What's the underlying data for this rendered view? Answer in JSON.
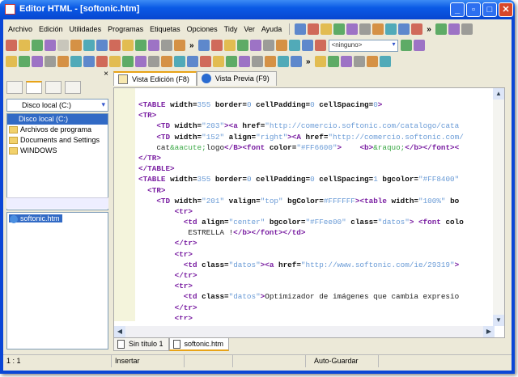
{
  "window": {
    "title": "Editor HTML - [softonic.htm]",
    "controls": [
      "_",
      "▫",
      "□",
      "✕"
    ]
  },
  "menu": [
    "Archivo",
    "Edición",
    "Utilidades",
    "Programas",
    "Etiquetas",
    "Opciones",
    "Tidy",
    "Ver",
    "Ayuda"
  ],
  "toolbar": {
    "chevron": "»",
    "style_select": "<ninguno>"
  },
  "toolbar_icons": {
    "row1": [
      "tag-icon",
      "wand-icon",
      "link-icon",
      "mail-icon",
      "image-icon",
      "table-icon",
      "form-icon",
      "check-icon",
      "bulb-icon",
      "code-icon",
      "more-icon",
      "frame-icon",
      "tool-icon",
      "undo-icon"
    ],
    "row2": [
      "new-file-icon",
      "new-template-icon",
      "open-icon",
      "open-remote-icon",
      "save-disabled-icon",
      "save-icon",
      "save-all-icon",
      "folder-icon",
      "folder-open-icon",
      "copy-icon",
      "print-setup-icon",
      "print-preview-icon",
      "print-icon",
      "properties-icon",
      "more-icon",
      "page-icon",
      "person-icon",
      "wand-icon",
      "image-icon",
      "doc-icon",
      "frame-icon",
      "doc2-icon",
      "lock-icon",
      "globe-icon",
      "server-icon",
      "trash-icon",
      "trash2-icon"
    ],
    "row3": [
      "align-icon",
      "paragraph-icon",
      "bold-icon",
      "list-icon",
      "comment-icon",
      "edit-icon",
      "smiley-icon",
      "undo-icon",
      "redo-icon",
      "cut-icon",
      "copy-icon",
      "paste-icon",
      "eraser-icon",
      "box-icon",
      "find-icon",
      "replace-icon",
      "find-next-icon",
      "indent-icon",
      "outdent-icon",
      "clock-icon",
      "font-color-icon",
      "highlight-icon",
      "clear-format-icon",
      "more-icon",
      "book-icon",
      "help-icon",
      "globe-icon",
      "mail-icon",
      "person-icon",
      "info-icon"
    ]
  },
  "left_panel": {
    "drive": "Disco local (C:)",
    "tree": [
      "Disco local (C:)",
      "Archivos de programa",
      "Documents and Settings",
      "WINDOWS"
    ],
    "files": [
      "softonic.htm"
    ],
    "close": "×"
  },
  "editor_tabs": [
    "Vista Edición (F8)",
    "Vista Previa (F9)"
  ],
  "code": [
    [
      [
        "tg",
        "<TABLE "
      ],
      [
        "at",
        "width="
      ],
      [
        "vl",
        "355"
      ],
      [
        "at",
        " border="
      ],
      [
        "vl",
        "0"
      ],
      [
        "at",
        " cellPadding="
      ],
      [
        "vl",
        "0"
      ],
      [
        "at",
        " cellSpacing="
      ],
      [
        "vl",
        "0"
      ],
      [
        "tg",
        ">"
      ]
    ],
    [
      [
        "tg",
        "<TR>"
      ]
    ],
    [
      [
        "tx",
        "    "
      ],
      [
        "tg",
        "<TD "
      ],
      [
        "at",
        "width="
      ],
      [
        "vl",
        "\"203\""
      ],
      [
        "tg",
        ">"
      ],
      [
        "tg",
        "<a "
      ],
      [
        "at",
        "href="
      ],
      [
        "vl",
        "\"http://comercio.softonic.com/catalogo/cata"
      ]
    ],
    [
      [
        "tx",
        "    "
      ],
      [
        "tg",
        "<TD "
      ],
      [
        "at",
        "width="
      ],
      [
        "vl",
        "\"152\""
      ],
      [
        "at",
        " align="
      ],
      [
        "vl",
        "\"right\""
      ],
      [
        "tg",
        "><A "
      ],
      [
        "at",
        "href="
      ],
      [
        "vl",
        "\"http://comercio.softonic.com/"
      ]
    ],
    [
      [
        "tx",
        "    cat"
      ],
      [
        "en",
        "&aacute;"
      ],
      [
        "tx",
        "logo"
      ],
      [
        "tg",
        "</B><font "
      ],
      [
        "at",
        "color="
      ],
      [
        "vl",
        "\"#FF6600\""
      ],
      [
        "tg",
        ">"
      ],
      [
        "tx",
        "    "
      ],
      [
        "tg",
        "<b>"
      ],
      [
        "en",
        "&raquo;"
      ],
      [
        "tg",
        "</b></font><"
      ]
    ],
    [
      [
        "tg",
        "</TR>"
      ]
    ],
    [
      [
        "tg",
        "</TABLE>"
      ]
    ],
    [
      [
        "tg",
        "<TABLE "
      ],
      [
        "at",
        "width="
      ],
      [
        "vl",
        "355"
      ],
      [
        "at",
        " border="
      ],
      [
        "vl",
        "0"
      ],
      [
        "at",
        " cellPadding="
      ],
      [
        "vl",
        "0"
      ],
      [
        "at",
        " cellSpacing="
      ],
      [
        "vl",
        "1"
      ],
      [
        "at",
        " bgcolor="
      ],
      [
        "vl",
        "\"#FF8400\""
      ]
    ],
    [
      [
        "tx",
        "  "
      ],
      [
        "tg",
        "<TR>"
      ]
    ],
    [
      [
        "tx",
        "    "
      ],
      [
        "tg",
        "<TD "
      ],
      [
        "at",
        "width="
      ],
      [
        "vl",
        "\"201\""
      ],
      [
        "at",
        " valign="
      ],
      [
        "vl",
        "\"top\""
      ],
      [
        "at",
        " bgColor="
      ],
      [
        "vl",
        "#FFFFFF"
      ],
      [
        "tg",
        "><table "
      ],
      [
        "at",
        "width="
      ],
      [
        "vl",
        "\"100%\""
      ],
      [
        "at",
        " bo"
      ]
    ],
    [
      [
        "tx",
        "        "
      ],
      [
        "tg",
        "<tr>"
      ]
    ],
    [
      [
        "tx",
        "          "
      ],
      [
        "tg",
        "<td "
      ],
      [
        "at",
        "align="
      ],
      [
        "vl",
        "\"center\""
      ],
      [
        "at",
        " bgcolor="
      ],
      [
        "vl",
        "\"#FFee00\""
      ],
      [
        "at",
        " class="
      ],
      [
        "vl",
        "\"datos\""
      ],
      [
        "tg",
        "> <font "
      ],
      [
        "at",
        "colo"
      ]
    ],
    [
      [
        "tx",
        "           ESTRELLA !"
      ],
      [
        "tg",
        "</b></font></td>"
      ]
    ],
    [
      [
        "tx",
        "        "
      ],
      [
        "tg",
        "</tr>"
      ]
    ],
    [
      [
        "tx",
        "        "
      ],
      [
        "tg",
        "<tr>"
      ]
    ],
    [
      [
        "tx",
        "          "
      ],
      [
        "tg",
        "<td "
      ],
      [
        "at",
        "class="
      ],
      [
        "vl",
        "\"datos\""
      ],
      [
        "tg",
        "><a "
      ],
      [
        "at",
        "href="
      ],
      [
        "vl",
        "\"http://www.softonic.com/ie/29319\""
      ],
      [
        "tg",
        ">"
      ]
    ],
    [
      [
        "tx",
        "        "
      ],
      [
        "tg",
        "</tr>"
      ]
    ],
    [
      [
        "tx",
        "        "
      ],
      [
        "tg",
        "<tr>"
      ]
    ],
    [
      [
        "tx",
        "          "
      ],
      [
        "tg",
        "<td "
      ],
      [
        "at",
        "class="
      ],
      [
        "vl",
        "\"datos\""
      ],
      [
        "tg",
        ">"
      ],
      [
        "tx",
        "Optimizador de imágenes que cambia expresio"
      ]
    ],
    [
      [
        "tx",
        "        "
      ],
      [
        "tg",
        "</tr>"
      ]
    ],
    [
      [
        "tx",
        "        "
      ],
      [
        "tg",
        "<tr>"
      ]
    ]
  ],
  "file_tabs": [
    "Sin título 1",
    "softonic.htm"
  ],
  "status": {
    "position": "1 : 1",
    "mode": "Insertar",
    "autosave": "Auto-Guardar"
  }
}
